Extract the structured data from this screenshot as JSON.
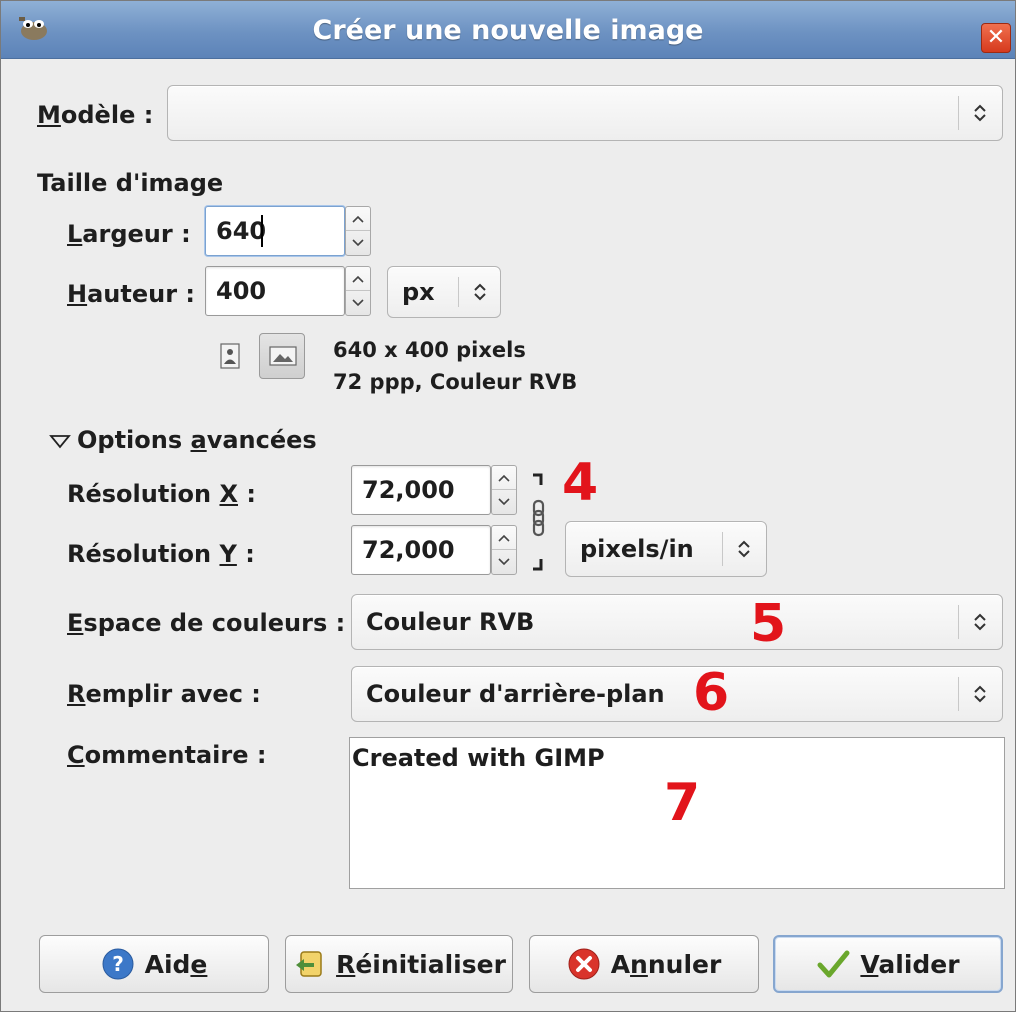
{
  "window": {
    "title": "Créer une nouvelle image",
    "close_glyph": "✕"
  },
  "template": {
    "label": "Modèle :",
    "mnemonic": "M",
    "label_rest": "odèle :",
    "value": ""
  },
  "image_size": {
    "section_title": "Taille d'image",
    "width": {
      "label_mnemonic": "L",
      "label_rest": "argeur :",
      "value": "640"
    },
    "height": {
      "label_mnemonic": "H",
      "label_rest": "auteur :",
      "value": "400"
    },
    "unit": "px",
    "info_line1": "640 x 400 pixels",
    "info_line2": "72 ppp, Couleur RVB",
    "orientation_icons": [
      "portrait-icon",
      "landscape-icon"
    ]
  },
  "advanced": {
    "expander_label_pre": "Options ",
    "expander_mnemonic": "a",
    "expander_label_post": "vancées",
    "expanded": true,
    "res_x": {
      "label_pre": "Résolution ",
      "mnemonic": "X",
      "label_post": " :",
      "value": "72,000"
    },
    "res_y": {
      "label_pre": "Résolution ",
      "mnemonic": "Y",
      "label_post": " :",
      "value": "72,000"
    },
    "res_unit": "pixels/in",
    "colorspace": {
      "mnemonic": "E",
      "label_rest": "space de couleurs :",
      "value": "Couleur RVB"
    },
    "fill": {
      "mnemonic": "R",
      "label_rest": "emplir avec :",
      "value": "Couleur d'arrière-plan"
    },
    "comment": {
      "mnemonic": "C",
      "label_rest": "ommentaire :",
      "value": "Created with GIMP"
    }
  },
  "annotations": [
    "4",
    "5",
    "6",
    "7"
  ],
  "colors": {
    "annotation": "#e2141b",
    "title_bar": "#6d92c2"
  },
  "buttons": {
    "help": {
      "pre": "Aid",
      "mnemonic": "e",
      "post": "",
      "icon": "help-icon"
    },
    "reset": {
      "pre": "",
      "mnemonic": "R",
      "post": "éinitialiser",
      "icon": "reset-icon"
    },
    "cancel": {
      "pre": "A",
      "mnemonic": "n",
      "post": "nuler",
      "icon": "cancel-icon"
    },
    "ok": {
      "pre": "",
      "mnemonic": "V",
      "post": "alider",
      "icon": "check-icon"
    }
  }
}
